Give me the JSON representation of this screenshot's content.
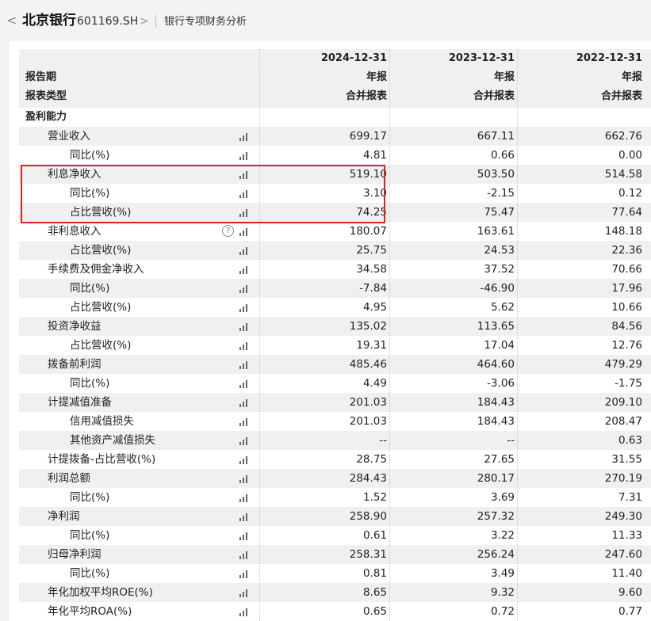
{
  "header": {
    "back_glyph": "<",
    "stock_name": "北京银行",
    "stock_code": "601169.SH",
    "chevron": ">",
    "breadcrumb": "银行专项财务分析"
  },
  "columns": {
    "report_period_label": "报告期",
    "report_type_label": "报表类型",
    "dates": [
      "2024-12-31",
      "2023-12-31",
      "2022-12-31"
    ],
    "period_types": [
      "年报",
      "年报",
      "年报"
    ],
    "report_types": [
      "合并报表",
      "合并报表",
      "合并报表"
    ]
  },
  "section": {
    "label": "盈利能力"
  },
  "rows": [
    {
      "label": "营业收入",
      "values": [
        "699.17",
        "667.11",
        "662.76"
      ],
      "indent": 1,
      "help": false
    },
    {
      "label": "同比(%)",
      "values": [
        "4.81",
        "0.66",
        "0.00"
      ],
      "indent": 2,
      "help": false
    },
    {
      "label": "利息净收入",
      "values": [
        "519.10",
        "503.50",
        "514.58"
      ],
      "indent": 1,
      "help": false
    },
    {
      "label": "同比(%)",
      "values": [
        "3.10",
        "-2.15",
        "0.12"
      ],
      "indent": 2,
      "help": false
    },
    {
      "label": "占比营收(%)",
      "values": [
        "74.25",
        "75.47",
        "77.64"
      ],
      "indent": 2,
      "help": false
    },
    {
      "label": "非利息收入",
      "values": [
        "180.07",
        "163.61",
        "148.18"
      ],
      "indent": 1,
      "help": true
    },
    {
      "label": "占比营收(%)",
      "values": [
        "25.75",
        "24.53",
        "22.36"
      ],
      "indent": 2,
      "help": false
    },
    {
      "label": "手续费及佣金净收入",
      "values": [
        "34.58",
        "37.52",
        "70.66"
      ],
      "indent": 1,
      "help": false
    },
    {
      "label": "同比(%)",
      "values": [
        "-7.84",
        "-46.90",
        "17.96"
      ],
      "indent": 2,
      "help": false
    },
    {
      "label": "占比营收(%)",
      "values": [
        "4.95",
        "5.62",
        "10.66"
      ],
      "indent": 2,
      "help": false
    },
    {
      "label": "投资净收益",
      "values": [
        "135.02",
        "113.65",
        "84.56"
      ],
      "indent": 1,
      "help": false
    },
    {
      "label": "占比营收(%)",
      "values": [
        "19.31",
        "17.04",
        "12.76"
      ],
      "indent": 2,
      "help": false
    },
    {
      "label": "拨备前利润",
      "values": [
        "485.46",
        "464.60",
        "479.29"
      ],
      "indent": 1,
      "help": false
    },
    {
      "label": "同比(%)",
      "values": [
        "4.49",
        "-3.06",
        "-1.75"
      ],
      "indent": 2,
      "help": false
    },
    {
      "label": "计提减值准备",
      "values": [
        "201.03",
        "184.43",
        "209.10"
      ],
      "indent": 1,
      "help": false
    },
    {
      "label": "信用减值损失",
      "values": [
        "201.03",
        "184.43",
        "208.47"
      ],
      "indent": 2,
      "help": false
    },
    {
      "label": "其他资产减值损失",
      "values": [
        "--",
        "--",
        "0.63"
      ],
      "indent": 2,
      "help": false
    },
    {
      "label": "计提拨备-占比营收(%)",
      "values": [
        "28.75",
        "27.65",
        "31.55"
      ],
      "indent": 1,
      "help": false
    },
    {
      "label": "利润总额",
      "values": [
        "284.43",
        "280.17",
        "270.19"
      ],
      "indent": 1,
      "help": false
    },
    {
      "label": "同比(%)",
      "values": [
        "1.52",
        "3.69",
        "7.31"
      ],
      "indent": 2,
      "help": false
    },
    {
      "label": "净利润",
      "values": [
        "258.90",
        "257.32",
        "249.30"
      ],
      "indent": 1,
      "help": false
    },
    {
      "label": "同比(%)",
      "values": [
        "0.61",
        "3.22",
        "11.33"
      ],
      "indent": 2,
      "help": false
    },
    {
      "label": "归母净利润",
      "values": [
        "258.31",
        "256.24",
        "247.60"
      ],
      "indent": 1,
      "help": false
    },
    {
      "label": "同比(%)",
      "values": [
        "0.81",
        "3.49",
        "11.40"
      ],
      "indent": 2,
      "help": false
    },
    {
      "label": "年化加权平均ROE(%)",
      "values": [
        "8.65",
        "9.32",
        "9.60"
      ],
      "indent": 1,
      "help": false
    },
    {
      "label": "年化平均ROA(%)",
      "values": [
        "0.65",
        "0.72",
        "0.77"
      ],
      "indent": 1,
      "help": false
    }
  ],
  "icons": {
    "chart": "bar-chart-icon",
    "help": "help-icon",
    "help_glyph": "?"
  },
  "colors": {
    "highlight": "#e02020",
    "row_alt": "#f0f0f0"
  }
}
